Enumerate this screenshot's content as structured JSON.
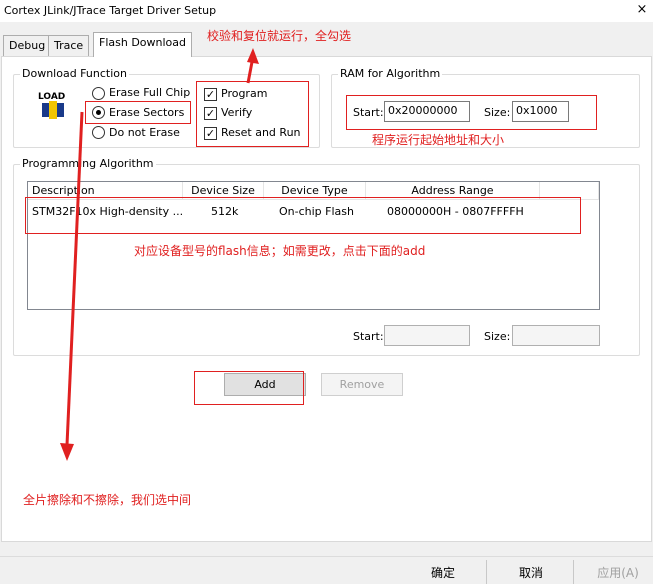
{
  "window": {
    "title": "Cortex JLink/JTrace Target Driver Setup",
    "close_glyph": "×"
  },
  "tabs": [
    "Debug",
    "Trace",
    "Flash Download"
  ],
  "download_function": {
    "label": "Download Function",
    "load_icon_text": "LOAD",
    "erase_options": [
      "Erase Full Chip",
      "Erase Sectors",
      "Do not Erase"
    ],
    "selected_erase": "Erase Sectors",
    "checkboxes": [
      {
        "label": "Program",
        "checked": true
      },
      {
        "label": "Verify",
        "checked": true
      },
      {
        "label": "Reset and Run",
        "checked": true
      }
    ]
  },
  "ram": {
    "label": "RAM for Algorithm",
    "start_label": "Start:",
    "start_value": "0x20000000",
    "size_label": "Size:",
    "size_value": "0x1000"
  },
  "programming": {
    "label": "Programming Algorithm",
    "columns": [
      "Description",
      "Device Size",
      "Device Type",
      "Address Range"
    ],
    "rows": [
      [
        "STM32F10x High-density ...",
        "512k",
        "On-chip Flash",
        "08000000H - 0807FFFFH"
      ]
    ],
    "start_label": "Start:",
    "size_label": "Size:"
  },
  "buttons": {
    "add": "Add",
    "remove": "Remove"
  },
  "footer": {
    "ok": "确定",
    "cancel": "取消",
    "apply": "应用(A)"
  },
  "annotations": {
    "checkboxes_note": "校验和复位就运行，全勾选",
    "ram_note": "程序运行起始地址和大小",
    "flash_note": "对应设备型号的flash信息；如需更改，点击下面的add",
    "erase_note": "全片擦除和不擦除，我们选中间",
    "color": "#e02020"
  }
}
